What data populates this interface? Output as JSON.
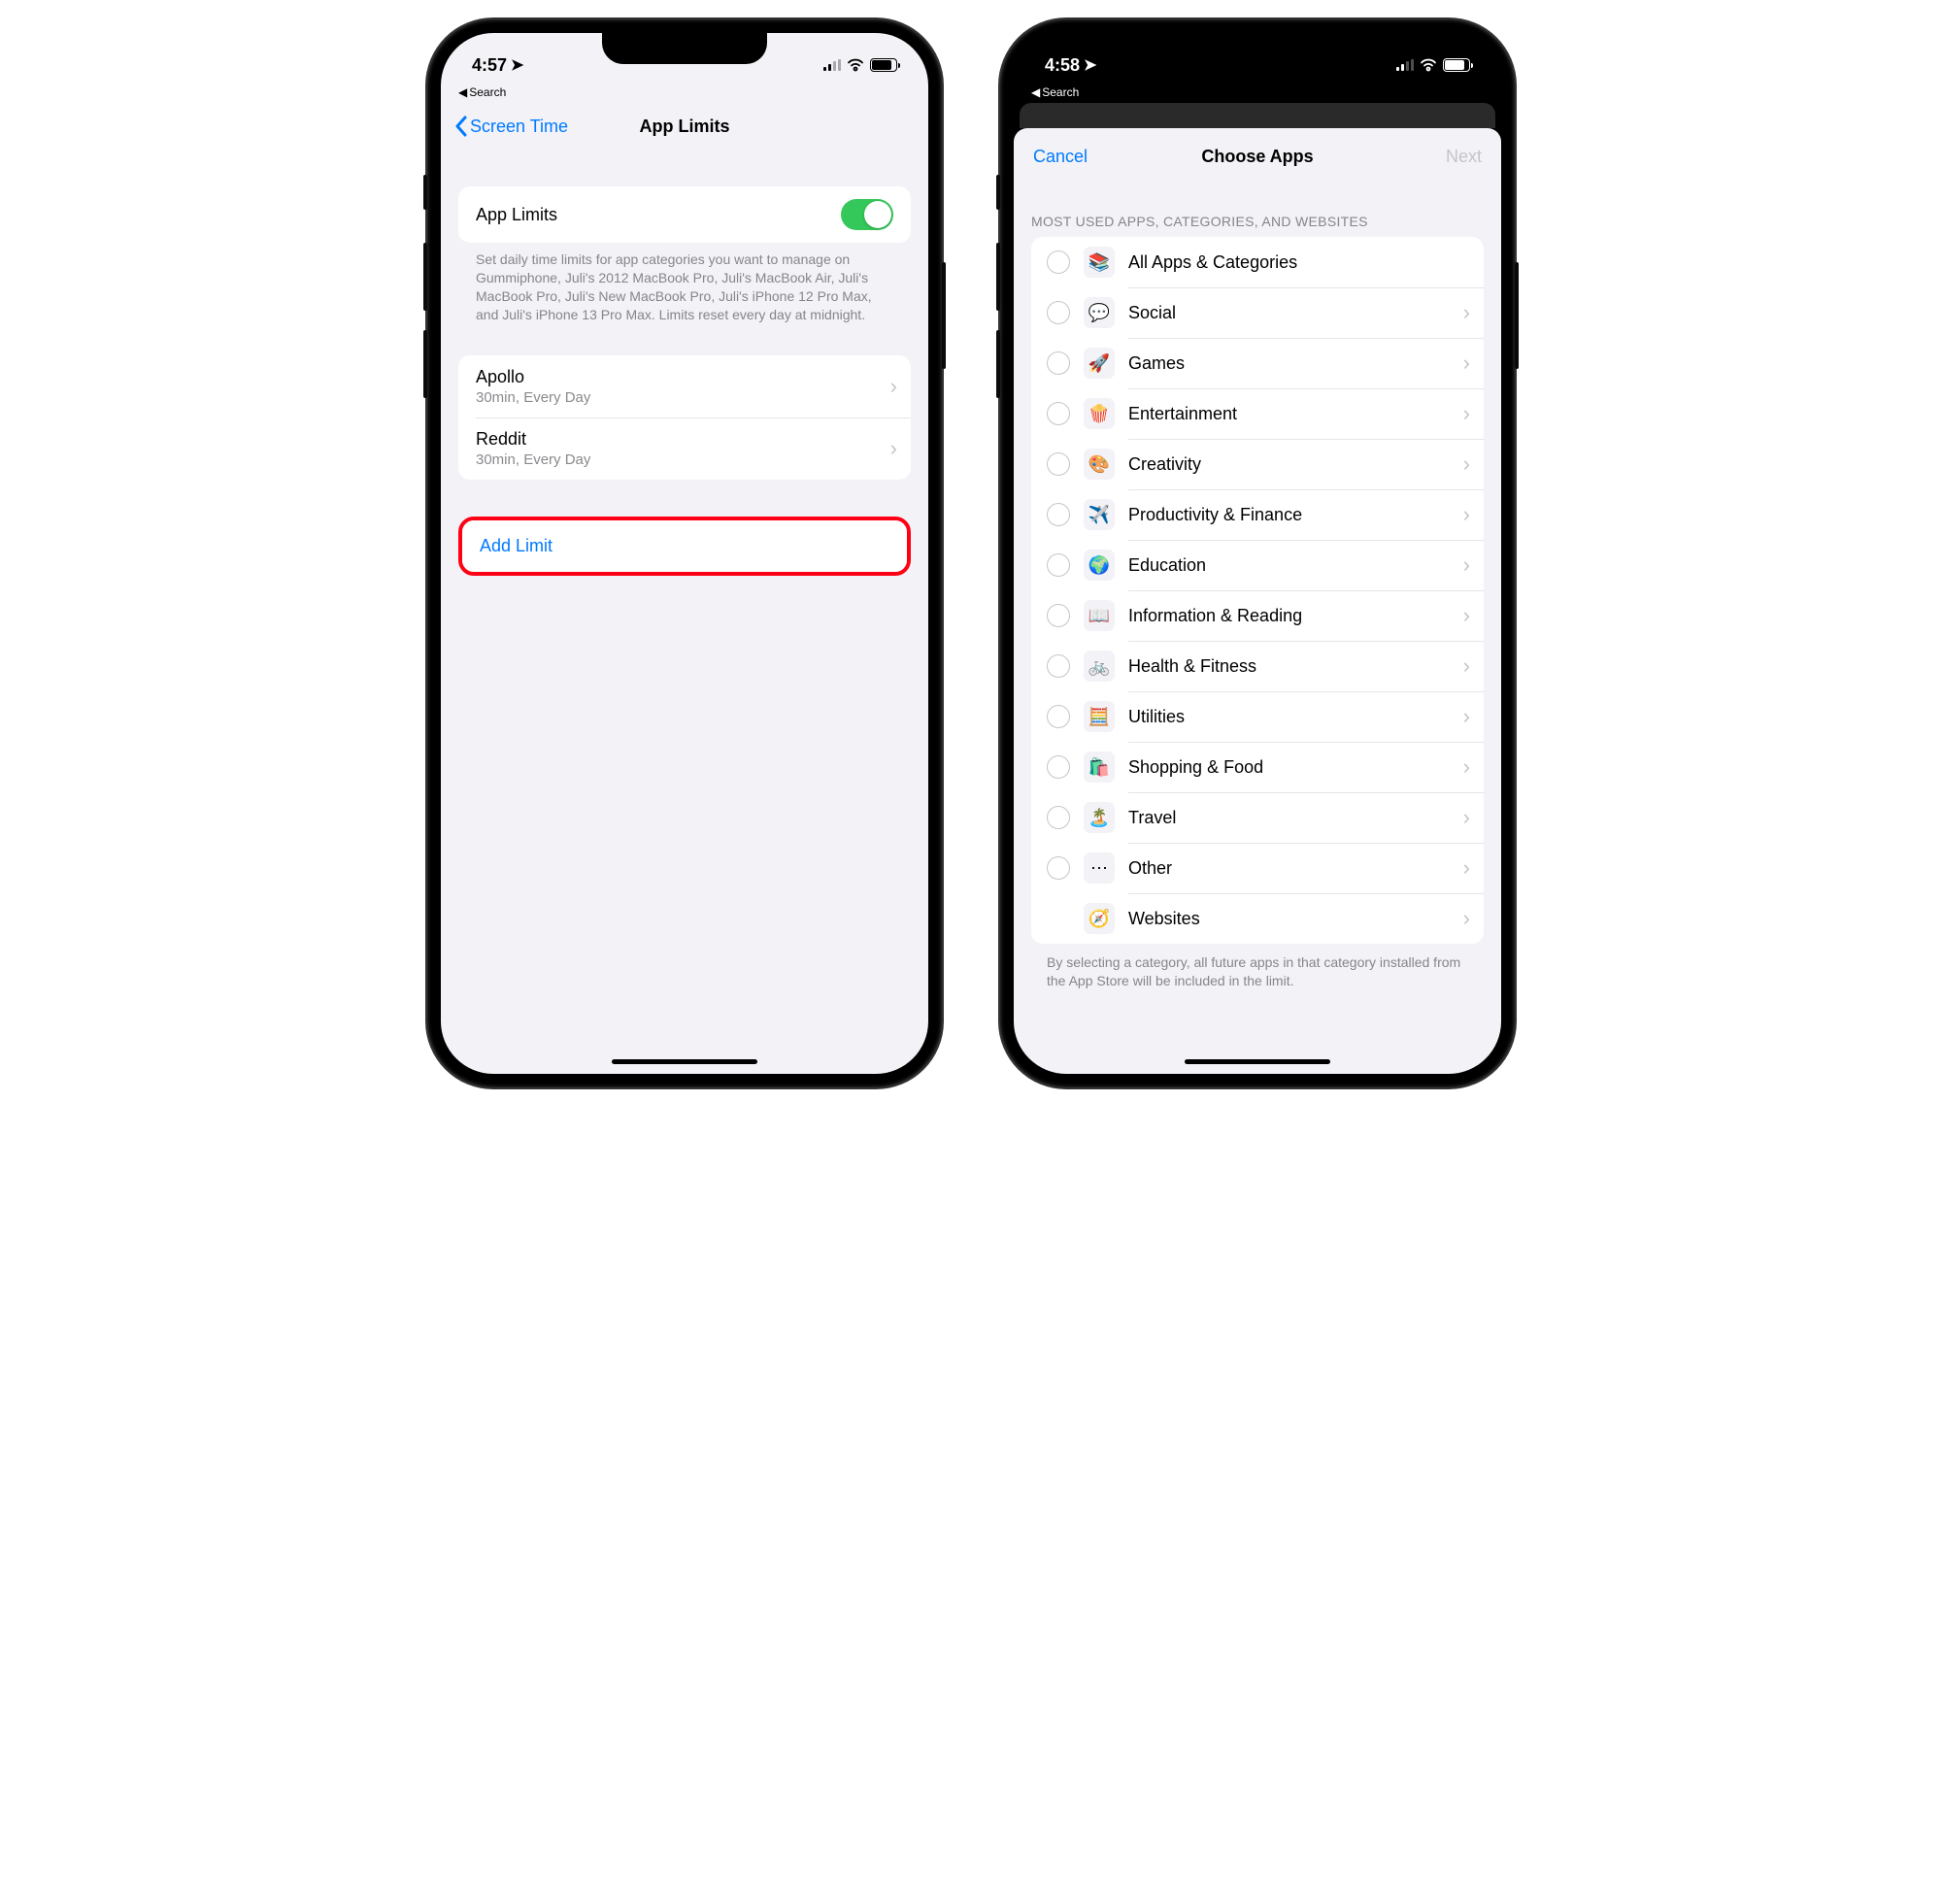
{
  "phone1": {
    "status": {
      "time": "4:57",
      "breadcrumb": "Search"
    },
    "nav": {
      "back": "Screen Time",
      "title": "App Limits"
    },
    "toggle": {
      "label": "App Limits"
    },
    "description": "Set daily time limits for app categories you want to manage on Gummiphone, Juli's 2012 MacBook Pro, Juli's MacBook Air, Juli's MacBook Pro, Juli's New MacBook Pro, Juli's iPhone 12 Pro Max, and Juli's iPhone 13 Pro Max. Limits reset every day at midnight.",
    "limits": [
      {
        "name": "Apollo",
        "detail": "30min, Every Day"
      },
      {
        "name": "Reddit",
        "detail": "30min, Every Day"
      }
    ],
    "addLimit": "Add Limit"
  },
  "phone2": {
    "status": {
      "time": "4:58",
      "breadcrumb": "Search"
    },
    "modal": {
      "cancel": "Cancel",
      "title": "Choose Apps",
      "next": "Next"
    },
    "sectionHeader": "MOST USED APPS, CATEGORIES, AND WEBSITES",
    "categories": [
      {
        "icon": "📚",
        "label": "All Apps & Categories",
        "chevron": false,
        "radio": true
      },
      {
        "icon": "💬",
        "label": "Social",
        "chevron": true,
        "radio": true
      },
      {
        "icon": "🚀",
        "label": "Games",
        "chevron": true,
        "radio": true
      },
      {
        "icon": "🍿",
        "label": "Entertainment",
        "chevron": true,
        "radio": true
      },
      {
        "icon": "🎨",
        "label": "Creativity",
        "chevron": true,
        "radio": true
      },
      {
        "icon": "✈️",
        "label": "Productivity & Finance",
        "chevron": true,
        "radio": true
      },
      {
        "icon": "🌍",
        "label": "Education",
        "chevron": true,
        "radio": true
      },
      {
        "icon": "📖",
        "label": "Information & Reading",
        "chevron": true,
        "radio": true
      },
      {
        "icon": "🚲",
        "label": "Health & Fitness",
        "chevron": true,
        "radio": true
      },
      {
        "icon": "🧮",
        "label": "Utilities",
        "chevron": true,
        "radio": true
      },
      {
        "icon": "🛍️",
        "label": "Shopping & Food",
        "chevron": true,
        "radio": true
      },
      {
        "icon": "🏝️",
        "label": "Travel",
        "chevron": true,
        "radio": true
      },
      {
        "icon": "⋯",
        "label": "Other",
        "chevron": true,
        "radio": true
      },
      {
        "icon": "🧭",
        "label": "Websites",
        "chevron": true,
        "radio": false
      }
    ],
    "footer": "By selecting a category, all future apps in that category installed from the App Store will be included in the limit."
  }
}
